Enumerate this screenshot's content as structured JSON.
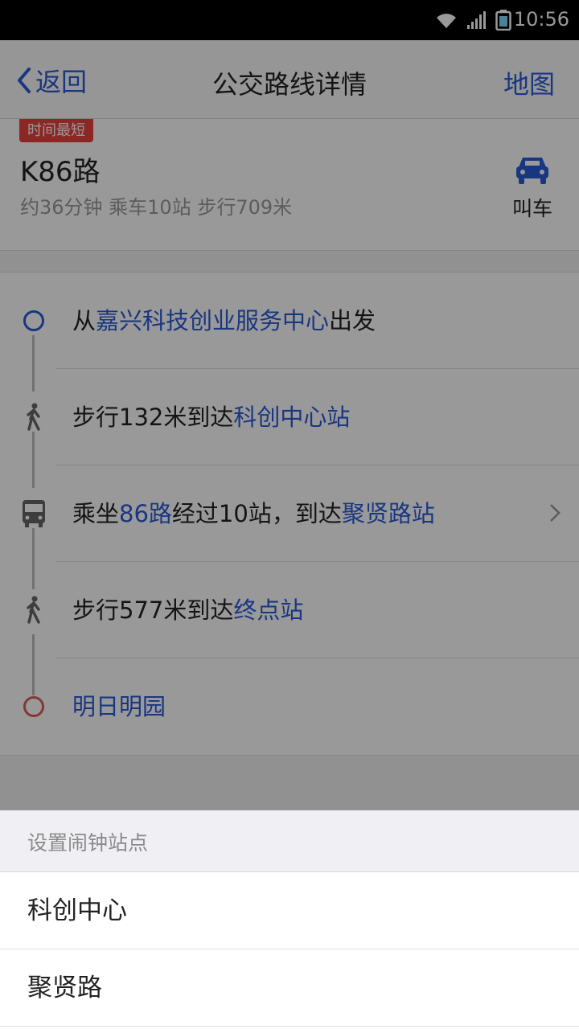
{
  "status_bar": {
    "time": "10:56"
  },
  "nav": {
    "back_label": "返回",
    "title": "公交路线详情",
    "map_label": "地图"
  },
  "summary": {
    "tag": "时间最短",
    "route_name": "K86路",
    "meta": "约36分钟 乘车10站 步行709米",
    "taxi_label": "叫车"
  },
  "steps": [
    {
      "pre": "从",
      "highlight": "嘉兴科技创业服务中心",
      "post": "出发"
    },
    {
      "pre": "步行132米到达",
      "highlight": "科创中心站",
      "post": ""
    },
    {
      "pre": "乘坐",
      "highlight": "86路",
      "mid": "经过10站，到达",
      "highlight2": "聚贤路站"
    },
    {
      "pre": "步行577米到达",
      "highlight": "终点站",
      "post": ""
    },
    {
      "pre": "",
      "highlight": "明日明园",
      "post": ""
    }
  ],
  "sheet": {
    "header": "设置闹钟站点",
    "options": [
      "科创中心",
      "聚贤路"
    ]
  },
  "colors": {
    "accent": "#2a5bd7",
    "tag": "#e8423f",
    "end_marker": "#e05a5a"
  }
}
